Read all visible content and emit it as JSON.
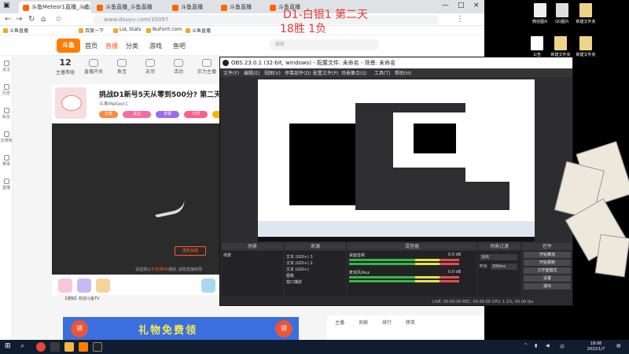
{
  "browser": {
    "tabs": [
      {
        "label": "斗鱼Meteor1直播_斗鱼直播"
      },
      {
        "label": "斗鱼直播_斗鱼直播"
      },
      {
        "label": "斗鱼直播"
      },
      {
        "label": "斗鱼直播"
      },
      {
        "label": "斗鱼直播"
      }
    ],
    "url": "www.douyu.com/10097",
    "bookmarks": [
      "斗鱼直播",
      "百度一下",
      "LoL Stats",
      "NuForrt.com",
      "斗鱼直播"
    ]
  },
  "douyu": {
    "logo": "斗鱼",
    "nav": [
      "首页",
      "直播",
      "分类",
      "游戏",
      "鱼吧"
    ],
    "search_placeholder": "搜索",
    "left_items": [
      "关注",
      "历史",
      "私信",
      "云游戏",
      "赛事",
      "直播"
    ],
    "subnav": [
      {
        "big": "12",
        "label": "主播等级"
      },
      {
        "big": "",
        "label": "直播开关"
      },
      {
        "big": "",
        "label": "鱼宝"
      },
      {
        "big": "",
        "label": "友邻"
      },
      {
        "big": "",
        "label": "活动"
      },
      {
        "big": "",
        "label": "实力主播"
      }
    ],
    "room_title": "挑战D1新号5天从零到500分? 第二天",
    "room_sub": "斗鱼Meteor1",
    "pills": [
      "分享",
      "关注",
      "举报",
      "订阅",
      "超管"
    ],
    "play_tip_a": "请选择以",
    "play_tip_b": "不支持H5",
    "play_tip_c": "播放, 获取直播权限",
    "play_button": "重新加载",
    "danmu": "【通知】欢迎斗鱼TV",
    "ad_text": "礼物免费领",
    "ad_badge": "领",
    "side_tabs": [
      "主播",
      "贡献",
      "排行",
      "榜单"
    ]
  },
  "overlay": {
    "line1": "D1-白银1 第二天",
    "line2": "18胜 1负"
  },
  "obs": {
    "title": "OBS 23.0.1 (32-bit, windows) - 配置文件: 未命名 - 场景: 未命名",
    "menu": [
      "文件(F)",
      "编辑(E)",
      "视图(V)",
      "停靠部件(D)",
      "配置文件(P)",
      "场景集合(S)",
      "工具(T)",
      "帮助(H)"
    ],
    "docks": [
      "场景",
      "来源",
      "混音器",
      "场景过渡",
      "控件"
    ],
    "scene_item": "场景",
    "sources": [
      "文本 (GDI+) 3",
      "文本 (GDI+) 2",
      "文本 (GDI+)",
      "图像",
      "窗口捕获"
    ],
    "mixer": [
      {
        "name": "桌面音频",
        "db": "0.0 dB"
      },
      {
        "name": "麦克风/Aux",
        "db": "0.0 dB"
      }
    ],
    "transition": "淡出",
    "duration_label": "时长",
    "duration": "300ms",
    "controls": [
      "开始推流",
      "开始录制",
      "工作室模式",
      "设置",
      "退出"
    ],
    "status": "LIVE: 00:00:00   REC: 00:00:00   CPU: 1.1%, 60.00 fps"
  },
  "desktop": {
    "icons": [
      {
        "label": "微信图片"
      },
      {
        "label": "QQ图片"
      },
      {
        "label": "新建文件夹"
      },
      {
        "label": "公告"
      },
      {
        "label": "新建文件夹"
      },
      {
        "label": "新建文件夹"
      }
    ]
  },
  "taskbar": {
    "time": "18:08",
    "date": "2022/1/7",
    "ime": "中"
  }
}
